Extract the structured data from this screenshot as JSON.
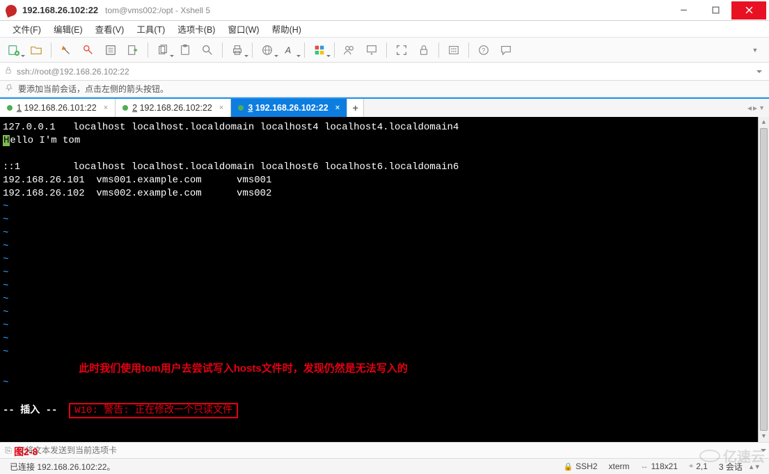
{
  "window": {
    "title_main": "192.168.26.102:22",
    "title_sub": "tom@vms002:/opt - Xshell 5"
  },
  "menu": {
    "items": [
      "文件(F)",
      "编辑(E)",
      "查看(V)",
      "工具(T)",
      "选项卡(B)",
      "窗口(W)",
      "帮助(H)"
    ]
  },
  "addressbar": {
    "url": "ssh://root@192.168.26.102:22"
  },
  "hint": {
    "text": "要添加当前会话，点击左侧的箭头按钮。"
  },
  "tabs": [
    {
      "num": "1",
      "label": "192.168.26.101:22",
      "active": false
    },
    {
      "num": "2",
      "label": "192.168.26.102:22",
      "active": false
    },
    {
      "num": "3",
      "label": "192.168.26.102:22",
      "active": true
    }
  ],
  "terminal": {
    "lines": [
      "127.0.0.1   localhost localhost.localdomain localhost4 localhost4.localdomain4",
      "::1         localhost localhost.localdomain localhost6 localhost6.localdomain6",
      "192.168.26.101  vms001.example.com      vms001",
      "192.168.26.102  vms002.example.com      vms002"
    ],
    "inserted_line_pre": "H",
    "inserted_line_post": "ello I'm tom",
    "tilde_count": 12,
    "mode_label": "-- 插入 --",
    "warning": "W10: 警告: 正在修改一个只读文件",
    "annotation": "此时我们使用tom用户去尝试写入hosts文件时，发现仍然是无法写入的"
  },
  "cmdline": {
    "placeholder": "仅将文本发送到当前选项卡"
  },
  "figure_label": "图2-8",
  "status": {
    "left": "已连接 192.168.26.102:22。",
    "proto": "SSH2",
    "term": "xterm",
    "size": "118x21",
    "pos": "2,1",
    "sessions": "3 会话"
  },
  "watermark": "亿速云"
}
